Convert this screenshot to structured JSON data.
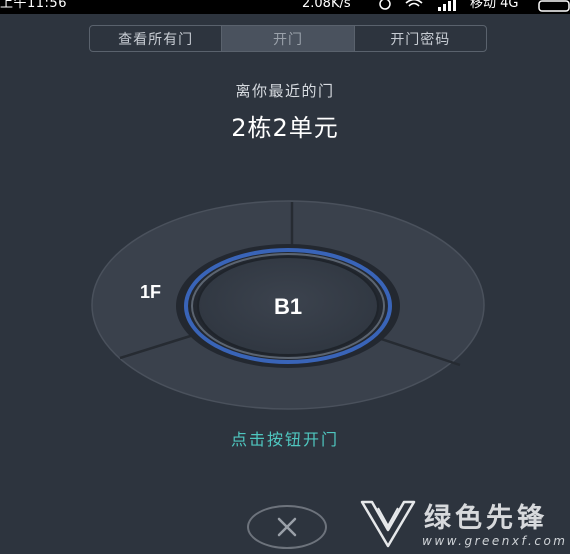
{
  "status_bar": {
    "time": "上午11:56",
    "network_speed": "2.08K/s",
    "carrier": "移动 4G"
  },
  "tabs": [
    {
      "label": "查看所有门",
      "active": false
    },
    {
      "label": "开门",
      "active": true
    },
    {
      "label": "开门密码",
      "active": false
    }
  ],
  "door": {
    "nearest_label": "离你最近的门",
    "name": "2栋2单元"
  },
  "dial": {
    "floor_label": "1F",
    "center_label": "B1"
  },
  "hint": "点击按钮开门",
  "close_icon": "close-icon",
  "watermark": {
    "title": "绿色先锋",
    "url": "www.greenxf.com"
  },
  "colors": {
    "background": "#2d343e",
    "accent": "#4fc7c0",
    "ring_blue": "#3d6fd0"
  }
}
